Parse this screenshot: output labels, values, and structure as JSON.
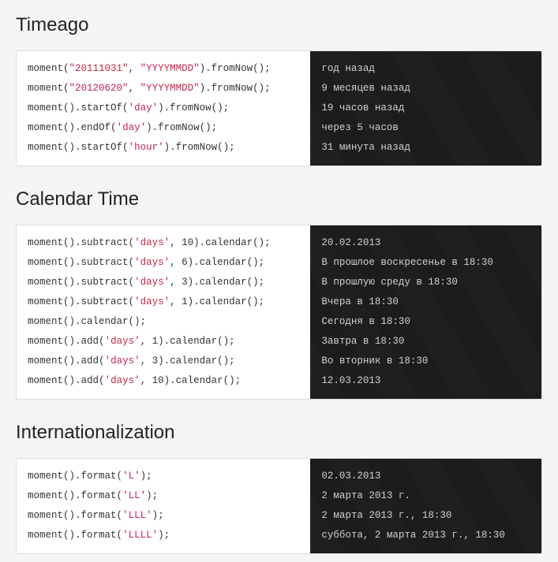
{
  "sections": [
    {
      "title": "Timeago",
      "rows": [
        {
          "tokens": [
            {
              "t": "func",
              "v": "moment"
            },
            {
              "t": "punc",
              "v": "("
            },
            {
              "t": "str",
              "v": "\"20111031\""
            },
            {
              "t": "punc",
              "v": ", "
            },
            {
              "t": "str",
              "v": "\"YYYYMMDD\""
            },
            {
              "t": "punc",
              "v": ")."
            },
            {
              "t": "func",
              "v": "fromNow"
            },
            {
              "t": "punc",
              "v": "();"
            }
          ],
          "output": "год назад"
        },
        {
          "tokens": [
            {
              "t": "func",
              "v": "moment"
            },
            {
              "t": "punc",
              "v": "("
            },
            {
              "t": "str",
              "v": "\"20120620\""
            },
            {
              "t": "punc",
              "v": ", "
            },
            {
              "t": "str",
              "v": "\"YYYYMMDD\""
            },
            {
              "t": "punc",
              "v": ")."
            },
            {
              "t": "func",
              "v": "fromNow"
            },
            {
              "t": "punc",
              "v": "();"
            }
          ],
          "output": "9 месяцев назад"
        },
        {
          "tokens": [
            {
              "t": "func",
              "v": "moment"
            },
            {
              "t": "punc",
              "v": "()."
            },
            {
              "t": "func",
              "v": "startOf"
            },
            {
              "t": "punc",
              "v": "("
            },
            {
              "t": "str",
              "v": "'day'"
            },
            {
              "t": "punc",
              "v": ")."
            },
            {
              "t": "func",
              "v": "fromNow"
            },
            {
              "t": "punc",
              "v": "();"
            }
          ],
          "output": "19 часов назад"
        },
        {
          "tokens": [
            {
              "t": "func",
              "v": "moment"
            },
            {
              "t": "punc",
              "v": "()."
            },
            {
              "t": "func",
              "v": "endOf"
            },
            {
              "t": "punc",
              "v": "("
            },
            {
              "t": "str",
              "v": "'day'"
            },
            {
              "t": "punc",
              "v": ")."
            },
            {
              "t": "func",
              "v": "fromNow"
            },
            {
              "t": "punc",
              "v": "();"
            }
          ],
          "output": "через 5 часов"
        },
        {
          "tokens": [
            {
              "t": "func",
              "v": "moment"
            },
            {
              "t": "punc",
              "v": "()."
            },
            {
              "t": "func",
              "v": "startOf"
            },
            {
              "t": "punc",
              "v": "("
            },
            {
              "t": "str",
              "v": "'hour'"
            },
            {
              "t": "punc",
              "v": ")."
            },
            {
              "t": "func",
              "v": "fromNow"
            },
            {
              "t": "punc",
              "v": "();"
            }
          ],
          "output": "31 минута назад"
        }
      ]
    },
    {
      "title": "Calendar Time",
      "rows": [
        {
          "tokens": [
            {
              "t": "func",
              "v": "moment"
            },
            {
              "t": "punc",
              "v": "()."
            },
            {
              "t": "func",
              "v": "subtract"
            },
            {
              "t": "punc",
              "v": "("
            },
            {
              "t": "str",
              "v": "'days'"
            },
            {
              "t": "punc",
              "v": ", 10)."
            },
            {
              "t": "func",
              "v": "calendar"
            },
            {
              "t": "punc",
              "v": "();"
            }
          ],
          "output": "20.02.2013"
        },
        {
          "tokens": [
            {
              "t": "func",
              "v": "moment"
            },
            {
              "t": "punc",
              "v": "()."
            },
            {
              "t": "func",
              "v": "subtract"
            },
            {
              "t": "punc",
              "v": "("
            },
            {
              "t": "str",
              "v": "'days'"
            },
            {
              "t": "punc",
              "v": ", 6)."
            },
            {
              "t": "func",
              "v": "calendar"
            },
            {
              "t": "punc",
              "v": "();"
            }
          ],
          "output": "В прошлое воскресенье в 18:30"
        },
        {
          "tokens": [
            {
              "t": "func",
              "v": "moment"
            },
            {
              "t": "punc",
              "v": "()."
            },
            {
              "t": "func",
              "v": "subtract"
            },
            {
              "t": "punc",
              "v": "("
            },
            {
              "t": "str",
              "v": "'days'"
            },
            {
              "t": "punc",
              "v": ", 3)."
            },
            {
              "t": "func",
              "v": "calendar"
            },
            {
              "t": "punc",
              "v": "();"
            }
          ],
          "output": "В прошлую среду в 18:30"
        },
        {
          "tokens": [
            {
              "t": "func",
              "v": "moment"
            },
            {
              "t": "punc",
              "v": "()."
            },
            {
              "t": "func",
              "v": "subtract"
            },
            {
              "t": "punc",
              "v": "("
            },
            {
              "t": "str",
              "v": "'days'"
            },
            {
              "t": "punc",
              "v": ", 1)."
            },
            {
              "t": "func",
              "v": "calendar"
            },
            {
              "t": "punc",
              "v": "();"
            }
          ],
          "output": "Вчера в 18:30"
        },
        {
          "tokens": [
            {
              "t": "func",
              "v": "moment"
            },
            {
              "t": "punc",
              "v": "()."
            },
            {
              "t": "func",
              "v": "calendar"
            },
            {
              "t": "punc",
              "v": "();"
            }
          ],
          "output": "Сегодня в 18:30"
        },
        {
          "tokens": [
            {
              "t": "func",
              "v": "moment"
            },
            {
              "t": "punc",
              "v": "()."
            },
            {
              "t": "func",
              "v": "add"
            },
            {
              "t": "punc",
              "v": "("
            },
            {
              "t": "str",
              "v": "'days'"
            },
            {
              "t": "punc",
              "v": ", 1)."
            },
            {
              "t": "func",
              "v": "calendar"
            },
            {
              "t": "punc",
              "v": "();"
            }
          ],
          "output": "Завтра в 18:30"
        },
        {
          "tokens": [
            {
              "t": "func",
              "v": "moment"
            },
            {
              "t": "punc",
              "v": "()."
            },
            {
              "t": "func",
              "v": "add"
            },
            {
              "t": "punc",
              "v": "("
            },
            {
              "t": "str",
              "v": "'days'"
            },
            {
              "t": "punc",
              "v": ", 3)."
            },
            {
              "t": "func",
              "v": "calendar"
            },
            {
              "t": "punc",
              "v": "();"
            }
          ],
          "output": "Во вторник в 18:30"
        },
        {
          "tokens": [
            {
              "t": "func",
              "v": "moment"
            },
            {
              "t": "punc",
              "v": "()."
            },
            {
              "t": "func",
              "v": "add"
            },
            {
              "t": "punc",
              "v": "("
            },
            {
              "t": "str",
              "v": "'days'"
            },
            {
              "t": "punc",
              "v": ", 10)."
            },
            {
              "t": "func",
              "v": "calendar"
            },
            {
              "t": "punc",
              "v": "();"
            }
          ],
          "output": "12.03.2013"
        }
      ]
    },
    {
      "title": "Internationalization",
      "rows": [
        {
          "tokens": [
            {
              "t": "func",
              "v": "moment"
            },
            {
              "t": "punc",
              "v": "()."
            },
            {
              "t": "func",
              "v": "format"
            },
            {
              "t": "punc",
              "v": "("
            },
            {
              "t": "str",
              "v": "'L'"
            },
            {
              "t": "punc",
              "v": ");"
            }
          ],
          "output": "02.03.2013"
        },
        {
          "tokens": [
            {
              "t": "func",
              "v": "moment"
            },
            {
              "t": "punc",
              "v": "()."
            },
            {
              "t": "func",
              "v": "format"
            },
            {
              "t": "punc",
              "v": "("
            },
            {
              "t": "str",
              "v": "'LL'"
            },
            {
              "t": "punc",
              "v": ");"
            }
          ],
          "output": "2 марта 2013 г."
        },
        {
          "tokens": [
            {
              "t": "func",
              "v": "moment"
            },
            {
              "t": "punc",
              "v": "()."
            },
            {
              "t": "func",
              "v": "format"
            },
            {
              "t": "punc",
              "v": "("
            },
            {
              "t": "str",
              "v": "'LLL'"
            },
            {
              "t": "punc",
              "v": ");"
            }
          ],
          "output": "2 марта 2013 г., 18:30"
        },
        {
          "tokens": [
            {
              "t": "func",
              "v": "moment"
            },
            {
              "t": "punc",
              "v": "()."
            },
            {
              "t": "func",
              "v": "format"
            },
            {
              "t": "punc",
              "v": "("
            },
            {
              "t": "str",
              "v": "'LLLL'"
            },
            {
              "t": "punc",
              "v": ");"
            }
          ],
          "output": "суббота, 2 марта 2013 г., 18:30"
        }
      ]
    }
  ]
}
